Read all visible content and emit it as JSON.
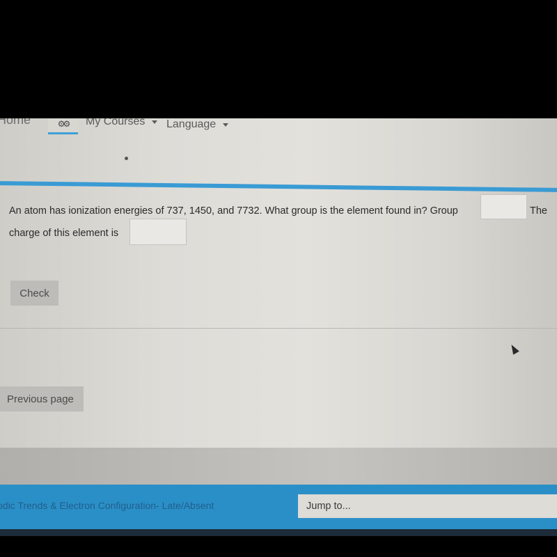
{
  "navbar": {
    "home_label": "Home",
    "gear_icon": "gears-icon",
    "my_courses_label": "My Courses",
    "language_label": "Language"
  },
  "question": {
    "text_line1": "An atom has ionization energies of 737, 1450, and 7732. What group is the element found in? Group",
    "group_answer": "",
    "text_after_group": "The",
    "text_line2": "charge of this element is",
    "charge_answer": ""
  },
  "buttons": {
    "check_label": "Check",
    "previous_page_label": "Previous page"
  },
  "footer": {
    "activity_link": "odic Trends & Electron Configuration- Late/Absent",
    "jump_to_label": "Jump to..."
  },
  "colors": {
    "accent_blue": "#3a9bd4",
    "footer_blue": "#2b8fc7"
  }
}
